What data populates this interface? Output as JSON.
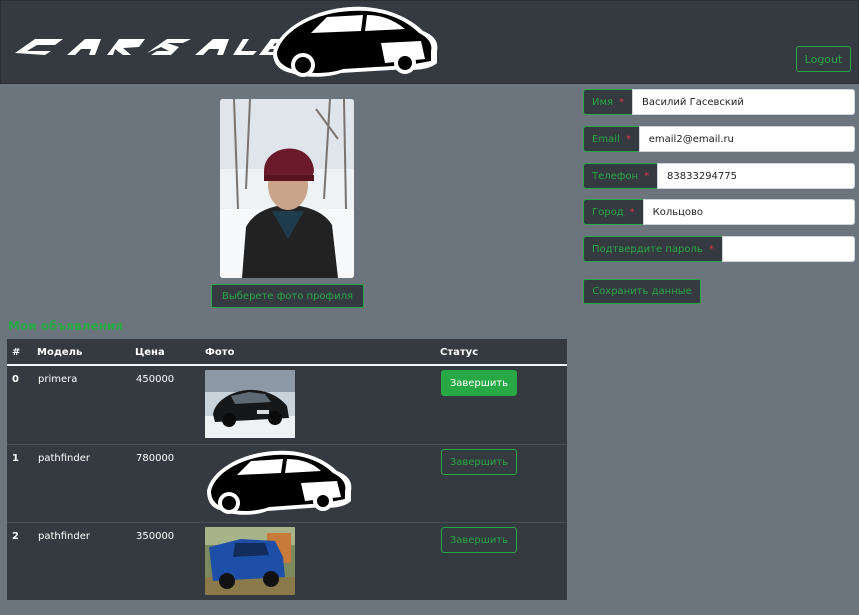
{
  "header": {
    "logo_text": "CARSALE",
    "logout_label": "Logout"
  },
  "profile": {
    "photo_button_label": "Выберете фото профиля"
  },
  "ads": {
    "title": "Мои объявления",
    "columns": [
      "#",
      "Модель",
      "Цена",
      "Фото",
      "Статус"
    ],
    "rows": [
      {
        "index": "0",
        "model": "primera",
        "price": "450000",
        "status_label": "Завершить"
      },
      {
        "index": "1",
        "model": "pathfinder",
        "price": "780000",
        "status_label": "Завершить"
      },
      {
        "index": "2",
        "model": "pathfinder",
        "price": "350000",
        "status_label": "Завершить"
      }
    ]
  },
  "form": {
    "name_label": "Имя",
    "name_value": "Василий Гасевский",
    "email_label": "Email",
    "email_value": "email2@email.ru",
    "phone_label": "Телефон",
    "phone_value": "83833294775",
    "city_label": "Город",
    "city_value": "Кольцово",
    "password_label": "Подтвердите пароль",
    "password_value": "",
    "required_mark": "*",
    "save_label": "Сохранить данные"
  },
  "colors": {
    "accent": "#28a745",
    "dark": "#343a40",
    "background": "#6c757d",
    "required": "#dc3545"
  }
}
